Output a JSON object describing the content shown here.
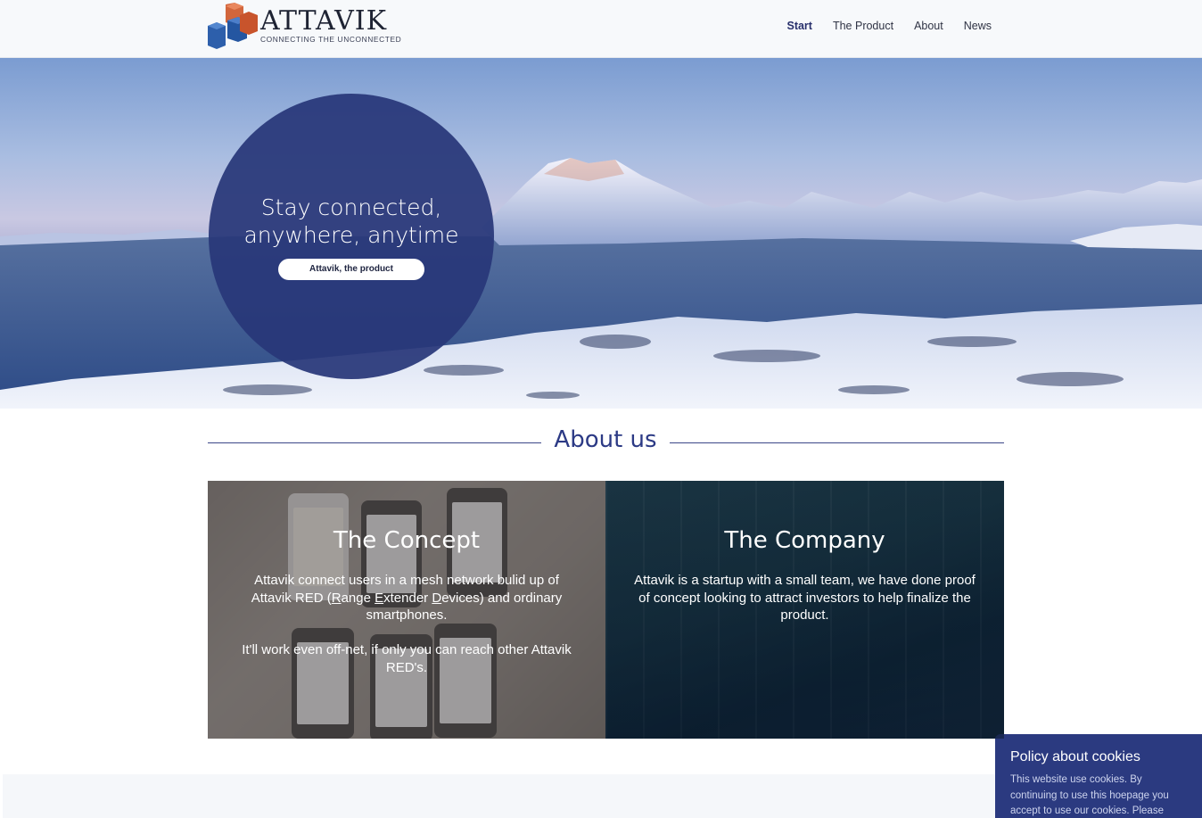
{
  "brand": {
    "name": "ATTAVIK",
    "tagline": "CONNECTING THE UNCONNECTED"
  },
  "nav": {
    "items": [
      {
        "label": "Start",
        "active": true
      },
      {
        "label": "The Product",
        "active": false
      },
      {
        "label": "About",
        "active": false
      },
      {
        "label": "News",
        "active": false
      }
    ]
  },
  "hero": {
    "title_line1": "Stay connected,",
    "title_line2": "anywhere, anytime",
    "button_label": "Attavik, the product"
  },
  "about": {
    "title": "About us",
    "concept": {
      "title": "The Concept",
      "text_before_r": "Attavik connect users in a mesh network bulid up of Attavik RED (",
      "r": "R",
      "text_ange": "ange ",
      "e": "E",
      "text_xtender": "xtender ",
      "d": "D",
      "text_after": "evices) and ordinary smartphones.",
      "text2": "It'll work even off-net, if only you can reach other Attavik RED's."
    },
    "company": {
      "title": "The Company",
      "text": "Attavik is a startup with a small team, we have done proof of concept looking to attract investors to help finalize the product."
    }
  },
  "cookie": {
    "title": "Policy about cookies",
    "text": "This website use cookies. By continuing to use this hoepage you accept to use our cookies. Please"
  },
  "colors": {
    "accent": "#2b3a80",
    "circle": "#28377a",
    "header_bg": "#f7f9fb"
  }
}
